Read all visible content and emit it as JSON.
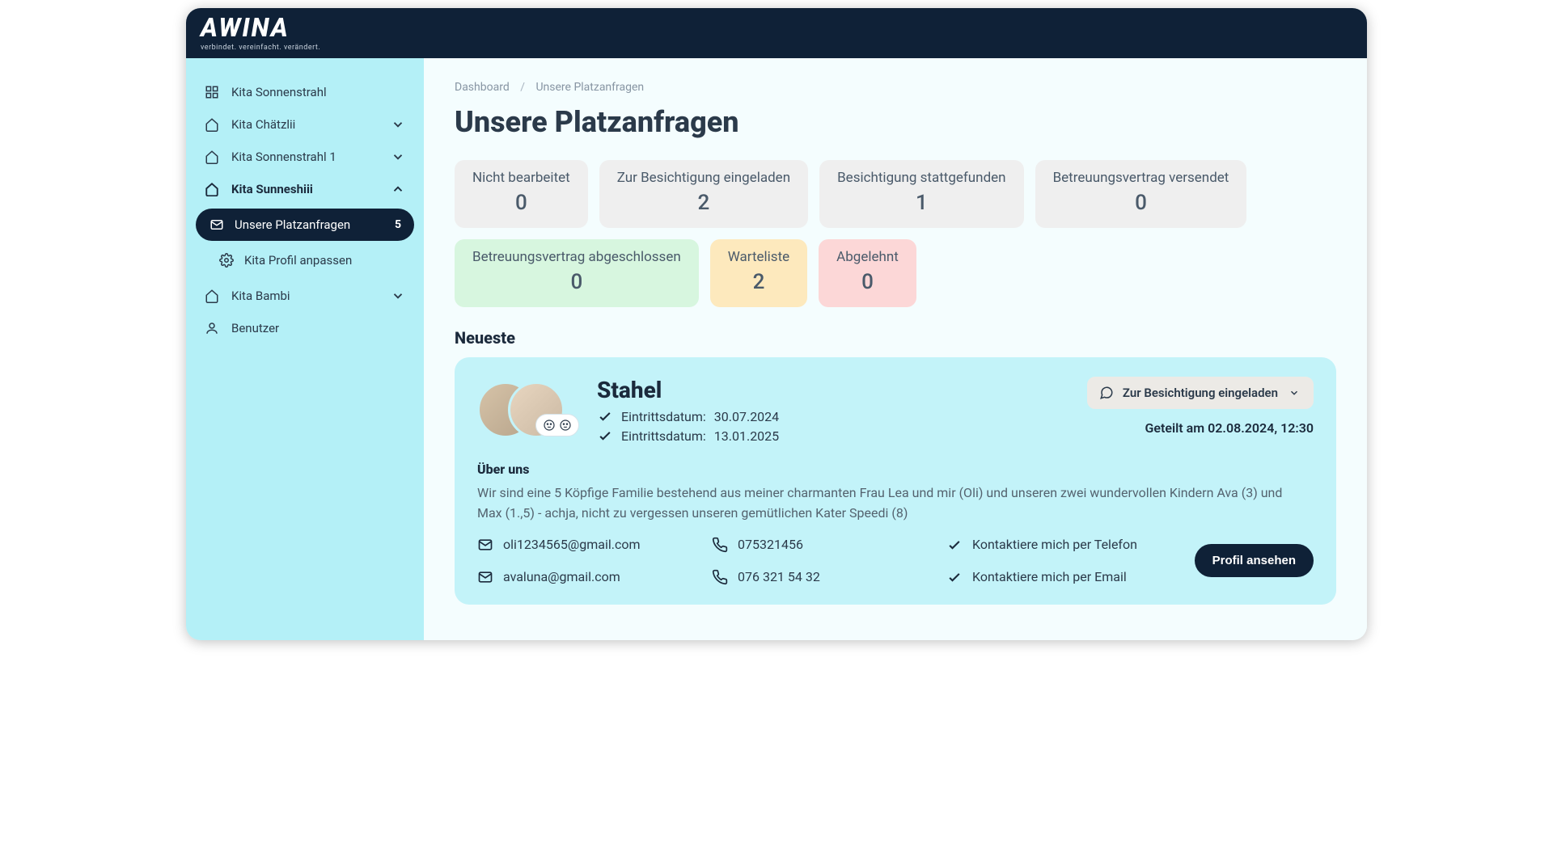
{
  "logo": {
    "text": "AWINA",
    "subtitle": "verbindet. vereinfacht. verändert."
  },
  "sidebar": {
    "item0": "Kita Sonnenstrahl",
    "item1": "Kita Chätzlii",
    "item2": "Kita Sonnenstrahl 1",
    "item3": "Kita Sunneshiii",
    "item3_sub0": "Unsere Platzanfragen",
    "item3_sub0_badge": "5",
    "item3_sub1": "Kita Profil anpassen",
    "item4": "Kita Bambi",
    "item5": "Benutzer"
  },
  "breadcrumb": {
    "root": "Dashboard",
    "current": "Unsere Platzanfragen"
  },
  "page_title": "Unsere Platzanfragen",
  "stats": [
    {
      "label": "Nicht bearbeitet",
      "value": "0",
      "bg": "#efefef"
    },
    {
      "label": "Zur Besichtigung eingeladen",
      "value": "2",
      "bg": "#efefef"
    },
    {
      "label": "Besichtigung stattgefunden",
      "value": "1",
      "bg": "#efefef"
    },
    {
      "label": "Betreuungsvertrag versendet",
      "value": "0",
      "bg": "#efefef"
    },
    {
      "label": "Betreuungsvertrag abgeschlossen",
      "value": "0",
      "bg": "#d7f6df"
    },
    {
      "label": "Warteliste",
      "value": "2",
      "bg": "#fde9bd"
    },
    {
      "label": "Abgelehnt",
      "value": "0",
      "bg": "#fcd7d7"
    }
  ],
  "section_latest": "Neueste",
  "request": {
    "name": "Stahel",
    "entry_label": "Eintrittsdatum:",
    "entry1": "30.07.2024",
    "entry2": "13.01.2025",
    "status": "Zur Besichtigung eingeladen",
    "shared": "Geteilt am 02.08.2024, 12:30",
    "about_title": "Über uns",
    "about_text": "Wir sind eine 5 Köpfige Familie bestehend aus meiner charmanten Frau Lea und mir (Oli) und unseren zwei wundervollen Kindern Ava (3) und Max (1.,5) - achja, nicht zu vergessen unseren gemütlichen Kater Speedi (8)",
    "email1": "oli1234565@gmail.com",
    "email2": "avaluna@gmail.com",
    "phone1": "075321456",
    "phone2": "076 321 54 32",
    "pref1": "Kontaktiere mich per Telefon",
    "pref2": "Kontaktiere mich per Email",
    "profile_btn": "Profil ansehen"
  }
}
